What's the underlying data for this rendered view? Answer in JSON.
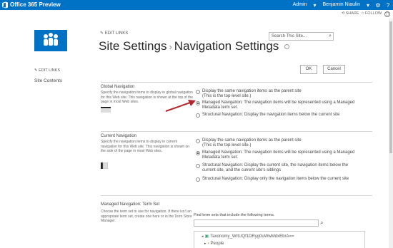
{
  "suite": {
    "brand": "Office 365 Preview",
    "user": "Benjamin Niaulin",
    "admin": "Admin",
    "colors": {
      "bar": "#0072c6"
    }
  },
  "actions": {
    "share": "SHARE",
    "follow": "FOLLOW"
  },
  "header": {
    "edit_links": "EDIT LINKS",
    "title_part1": "Site Settings",
    "title_sep": "›",
    "title_part2": "Navigation Settings",
    "search_placeholder": "Search This Site..."
  },
  "leftnav": {
    "edit_links": "EDIT LINKS",
    "site_contents": "Site Contents"
  },
  "buttons": {
    "ok": "OK",
    "cancel": "Cancel"
  },
  "global_nav": {
    "title": "Global Navigation",
    "desc": "Specify the navigation items to display in global navigation for this Web site. This navigation is shown at the top of the page in most Web sites.",
    "options": [
      {
        "line1": "Display the same navigation items as the parent site",
        "line2": "(This is the top-level site.)",
        "selected": false
      },
      {
        "line1": "Managed Navigation: The navigation items will be represented using a Managed",
        "line2": "Metadata term set.",
        "selected": true
      },
      {
        "line1": "Structural Navigation: Display the navigation items below the current site",
        "line2": "",
        "selected": false
      }
    ]
  },
  "current_nav": {
    "title": "Current Navigation",
    "desc": "Specify the navigation items to display in current navigation for this Web site. This navigation is shown on the side of the page in most Web sites.",
    "options": [
      {
        "line1": "Display the same navigation items as the parent site",
        "line2": "(This is the top-level site.)",
        "selected": false
      },
      {
        "line1": "Managed Navigation: The navigation items will be represented using a Managed",
        "line2": "Metadata term set.",
        "selected": true
      },
      {
        "line1": "Structural Navigation: Display the current site, the navigation items below the",
        "line2": "current site, and the current site's siblings",
        "selected": false
      },
      {
        "line1": "Structural Navigation: Display only the navigation items below the current site",
        "line2": "",
        "selected": false
      }
    ]
  },
  "term_set": {
    "title": "Managed Navigation: Term Set",
    "desc": "Choose the term set to use for navigation. If there isn't an appropriate term set, create one here or in the Term Store Manager.",
    "find_label": "Find term sets that include the following terms.",
    "tree": [
      {
        "label": "Taxonomy_WrtUQf1DRyg0uWwMdxEbrA==",
        "icon": "taxonomy-icon"
      },
      {
        "label": "People",
        "icon": "folder-icon"
      }
    ]
  }
}
